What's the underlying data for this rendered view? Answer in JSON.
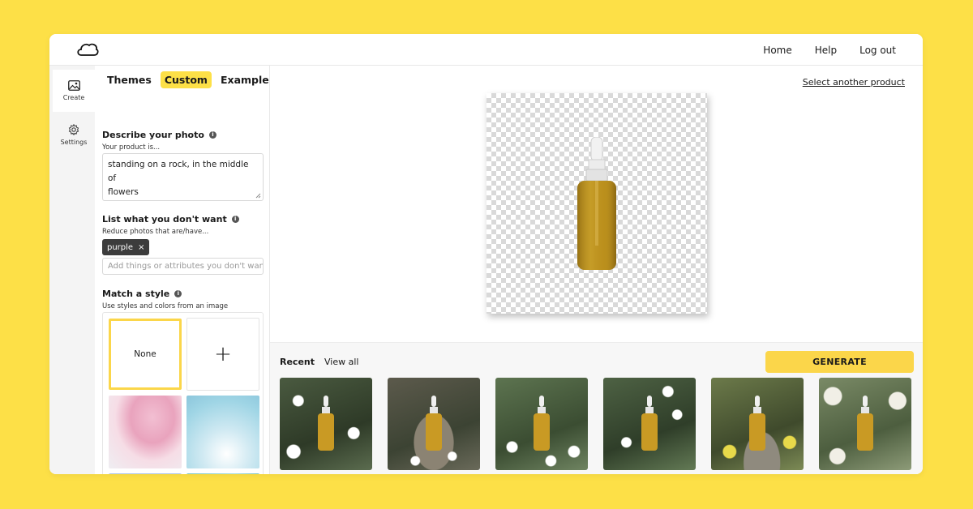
{
  "nav": {
    "home": "Home",
    "help": "Help",
    "logout": "Log out"
  },
  "rail": {
    "create": "Create",
    "settings": "Settings"
  },
  "tabs": {
    "themes": "Themes",
    "custom": "Custom",
    "examples": "Examples"
  },
  "describe": {
    "title": "Describe your photo",
    "subtitle": "Your product is...",
    "value_line1": "standing on a rock, in the middle of",
    "value_line2": "flowers"
  },
  "exclude": {
    "title": "List what you don't want",
    "subtitle": "Reduce photos that are/have...",
    "chip": "purple",
    "chip_close": "×",
    "placeholder": "Add things or attributes you don't want"
  },
  "style": {
    "title": "Match a style",
    "subtitle": "Use styles and colors from an image",
    "none_label": "None",
    "add_label": "+"
  },
  "main": {
    "select_product": "Select another product"
  },
  "bottom": {
    "recent": "Recent",
    "view_all": "View all",
    "generate": "GENERATE"
  },
  "colors": {
    "accent": "#fbd64a",
    "background": "#fde047"
  }
}
